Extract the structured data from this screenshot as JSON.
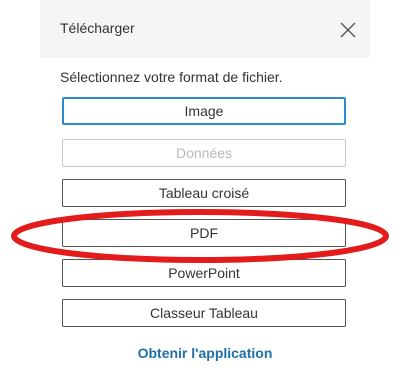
{
  "dialog": {
    "title": "Télécharger",
    "close_icon": "close-icon",
    "prompt": "Sélectionnez votre format de fichier.",
    "options": [
      {
        "label": "Image",
        "state": "focused"
      },
      {
        "label": "Données",
        "state": "disabled"
      },
      {
        "label": "Tableau croisé",
        "state": "enabled"
      },
      {
        "label": "PDF",
        "state": "enabled"
      },
      {
        "label": "PowerPoint",
        "state": "enabled"
      },
      {
        "label": "Classeur Tableau",
        "state": "enabled"
      }
    ],
    "app_link": "Obtenir l'application"
  },
  "annotation": {
    "color": "#e31b1b",
    "shape": "ellipse"
  },
  "colors": {
    "header_bg": "#f5f5f5",
    "focus_border": "#2c8ad0",
    "link": "#1f6fa8"
  }
}
